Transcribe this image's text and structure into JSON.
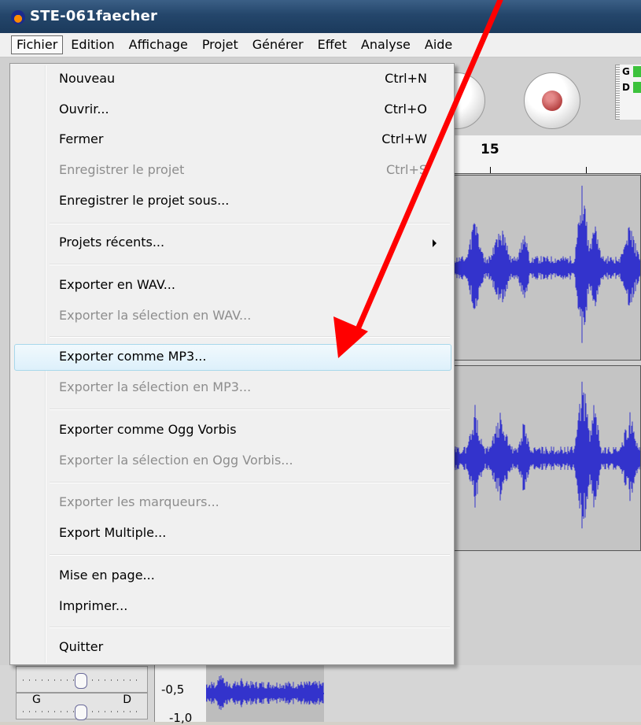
{
  "window": {
    "title": "STE-061faecher",
    "icon": "audacity-app-icon"
  },
  "menubar": {
    "items": [
      "Fichier",
      "Edition",
      "Affichage",
      "Projet",
      "Générer",
      "Effet",
      "Analyse",
      "Aide"
    ],
    "active": "Fichier"
  },
  "fichier_menu": {
    "items": [
      {
        "label": "Nouveau",
        "shortcut": "Ctrl+N",
        "enabled": true
      },
      {
        "label": "Ouvrir...",
        "shortcut": "Ctrl+O",
        "enabled": true
      },
      {
        "label": "Fermer",
        "shortcut": "Ctrl+W",
        "enabled": true
      },
      {
        "label": "Enregistrer le projet",
        "shortcut": "Ctrl+S",
        "enabled": false
      },
      {
        "label": "Enregistrer le projet sous...",
        "shortcut": "",
        "enabled": true
      },
      {
        "label": "Projets récents...",
        "shortcut": "",
        "enabled": true,
        "submenu": true
      },
      {
        "label": "Exporter en WAV...",
        "shortcut": "",
        "enabled": true
      },
      {
        "label": "Exporter la sélection en WAV...",
        "shortcut": "",
        "enabled": false
      },
      {
        "label": "Exporter comme MP3...",
        "shortcut": "",
        "enabled": true,
        "highlighted": true
      },
      {
        "label": "Exporter la sélection en MP3...",
        "shortcut": "",
        "enabled": false
      },
      {
        "label": "Exporter comme Ogg Vorbis",
        "shortcut": "",
        "enabled": true
      },
      {
        "label": "Exporter la sélection en Ogg Vorbis...",
        "shortcut": "",
        "enabled": false
      },
      {
        "label": "Exporter les marqueurs...",
        "shortcut": "",
        "enabled": false
      },
      {
        "label": "Export Multiple...",
        "shortcut": "",
        "enabled": true
      },
      {
        "label": "Mise en page...",
        "shortcut": "",
        "enabled": true
      },
      {
        "label": "Imprimer...",
        "shortcut": "",
        "enabled": true
      },
      {
        "label": "Quitter",
        "shortcut": "",
        "enabled": true
      }
    ]
  },
  "toolbar": {
    "play_icon": "play-icon",
    "record_icon": "record-icon"
  },
  "meter": {
    "left_label": "G",
    "right_label": "D"
  },
  "timeline": {
    "tick_label": "15"
  },
  "track_panel": {
    "pan_left_label": "G",
    "pan_right_label": "D",
    "scale_labels": [
      "-0,5",
      "-1,0"
    ]
  },
  "annotation": {
    "color": "#ff0000",
    "meaning": "arrow-pointing-to-export-mp3"
  },
  "colors": {
    "waveform": "#3333cc",
    "menu_highlight_border": "#a8d8eb",
    "disabled_text": "#8d8d8d"
  }
}
